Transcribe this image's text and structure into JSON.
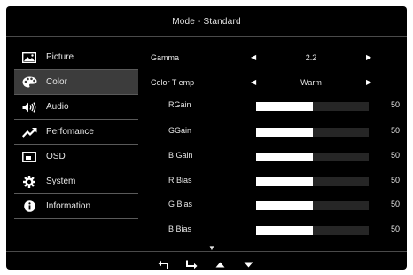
{
  "header": {
    "title": "Mode - Standard"
  },
  "sidebar": {
    "items": [
      {
        "label": "Picture",
        "icon": "picture-icon",
        "selected": false
      },
      {
        "label": "Color",
        "icon": "palette-icon",
        "selected": true
      },
      {
        "label": "Audio",
        "icon": "speaker-icon",
        "selected": false
      },
      {
        "label": "Perfomance",
        "icon": "trend-up-icon",
        "selected": false
      },
      {
        "label": "OSD",
        "icon": "osd-window-icon",
        "selected": false
      },
      {
        "label": "System",
        "icon": "gear-icon",
        "selected": false
      },
      {
        "label": "Information",
        "icon": "info-icon",
        "selected": false
      }
    ]
  },
  "settings": {
    "gamma": {
      "label": "Gamma",
      "value": "2.2"
    },
    "color_temp": {
      "label": "Color T emp",
      "value": "Warm"
    },
    "sliders": [
      {
        "label": "RGain",
        "value": "50",
        "fraction": 0.5
      },
      {
        "label": "GGain",
        "value": "50",
        "fraction": 0.5
      },
      {
        "label": "B Gain",
        "value": "50",
        "fraction": 0.5
      },
      {
        "label": "R Bias",
        "value": "50",
        "fraction": 0.5
      },
      {
        "label": "G Bias",
        "value": "50",
        "fraction": 0.5
      },
      {
        "label": "B Bias",
        "value": "50",
        "fraction": 0.5
      }
    ]
  },
  "footer": {
    "nav": [
      "back-icon",
      "enter-icon",
      "up-arrow-icon",
      "down-arrow-icon"
    ]
  },
  "colors": {
    "background": "#000000",
    "text": "#e6e6e6",
    "selected_row": "#3c3c3c",
    "slider_fill": "#ffffff"
  }
}
